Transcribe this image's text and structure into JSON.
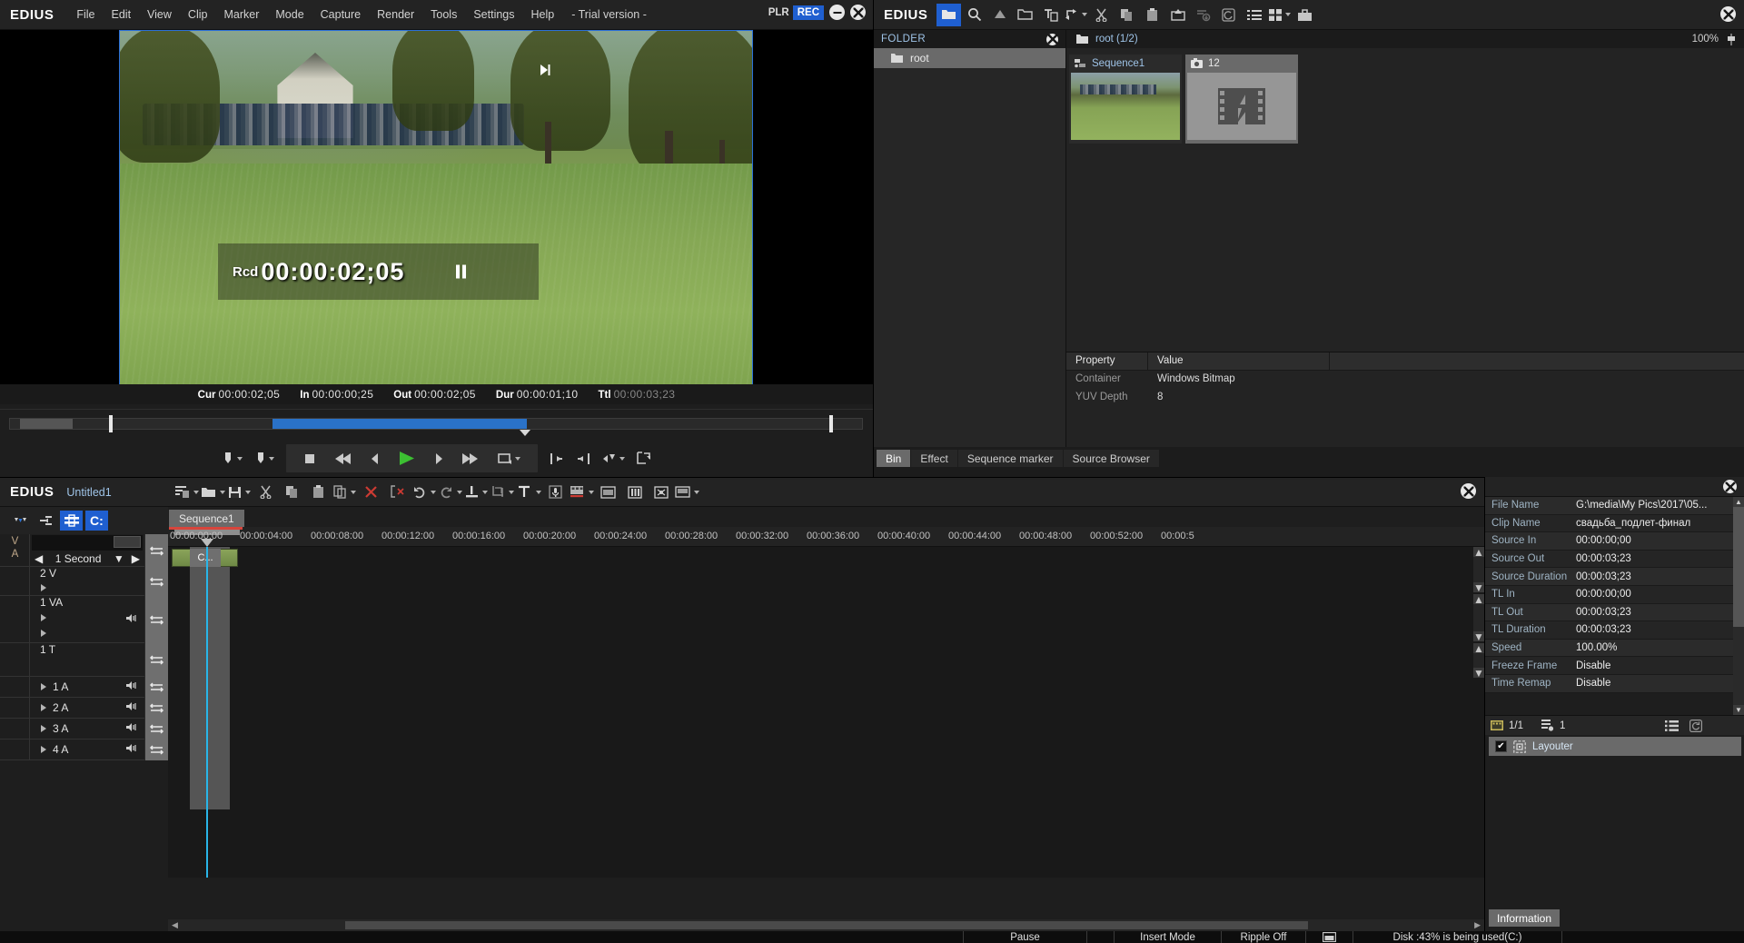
{
  "player": {
    "logo": "EDIUS",
    "menu": [
      "File",
      "Edit",
      "View",
      "Clip",
      "Marker",
      "Mode",
      "Capture",
      "Render",
      "Tools",
      "Settings",
      "Help"
    ],
    "trial": "- Trial version -",
    "plr_label": "PLR",
    "rec_label": "REC",
    "overlay": {
      "prefix": "Rcd",
      "timecode": "00:00:02;05"
    },
    "timecodes": [
      {
        "label": "Cur",
        "value": "00:00:02;05",
        "dim": false
      },
      {
        "label": "In",
        "value": "00:00:00;25",
        "dim": false
      },
      {
        "label": "Out",
        "value": "00:00:02;05",
        "dim": false
      },
      {
        "label": "Dur",
        "value": "00:00:01;10",
        "dim": false
      },
      {
        "label": "Ttl",
        "value": "00:00:03;23",
        "dim": true
      }
    ]
  },
  "bin": {
    "logo": "EDIUS",
    "folder_header": "FOLDER",
    "folder_item": "root",
    "path": "root (1/2)",
    "zoom": "100%",
    "cards": [
      {
        "name": "Sequence1",
        "kind": "sequence"
      },
      {
        "name": "12",
        "kind": "bitmap"
      }
    ],
    "property_headers": [
      "Property",
      "Value"
    ],
    "properties": [
      {
        "key": "Container",
        "value": "Windows Bitmap"
      },
      {
        "key": "YUV Depth",
        "value": "8"
      }
    ],
    "tabs": [
      "Bin",
      "Effect",
      "Sequence marker",
      "Source Browser"
    ],
    "active_tab": "Bin"
  },
  "timeline": {
    "logo": "EDIUS",
    "project_title": "Untitled1",
    "sequence_tab": "Sequence1",
    "zoom_scale": "1 Second",
    "va_labels": [
      "V",
      "A"
    ],
    "ruler_ticks": [
      "00:00:00:00",
      "00:00:04:00",
      "00:00:08:00",
      "00:00:12:00",
      "00:00:16:00",
      "00:00:20:00",
      "00:00:24:00",
      "00:00:28:00",
      "00:00:32:00",
      "00:00:36:00",
      "00:00:40:00",
      "00:00:44:00",
      "00:00:48:00",
      "00:00:52:00",
      "00:00:5"
    ],
    "tracks": [
      {
        "label": "2 V",
        "type": "video",
        "expanders": 1
      },
      {
        "label": "1 VA",
        "type": "videoaudio",
        "expanders": 2
      },
      {
        "label": "1 T",
        "type": "title",
        "expanders": 0
      },
      {
        "label": "1 A",
        "type": "audio",
        "expanders": 1
      },
      {
        "label": "2 A",
        "type": "audio",
        "expanders": 1
      },
      {
        "label": "3 A",
        "type": "audio",
        "expanders": 1
      },
      {
        "label": "4 A",
        "type": "audio",
        "expanders": 1
      }
    ],
    "clip_label": "C..."
  },
  "information": {
    "rows": [
      {
        "key": "File Name",
        "value": "G:\\media\\My Pics\\2017\\05..."
      },
      {
        "key": "Clip Name",
        "value": "свадьба_подлет-финал"
      },
      {
        "key": "Source In",
        "value": "00:00:00;00"
      },
      {
        "key": "Source Out",
        "value": "00:00:03;23"
      },
      {
        "key": "Source Duration",
        "value": "00:00:03;23"
      },
      {
        "key": "TL In",
        "value": "00:00:00;00"
      },
      {
        "key": "TL Out",
        "value": "00:00:03;23"
      },
      {
        "key": "TL Duration",
        "value": "00:00:03;23"
      },
      {
        "key": "Speed",
        "value": "100.00%"
      },
      {
        "key": "Freeze Frame",
        "value": "Disable"
      },
      {
        "key": "Time Remap",
        "value": "Disable"
      }
    ],
    "page_count": "1/1",
    "effect_count": "1",
    "effect_name": "Layouter",
    "tab_label": "Information"
  },
  "statusbar": {
    "pause": "Pause",
    "insert_mode": "Insert Mode",
    "ripple": "Ripple Off",
    "disk": "Disk :43% is being used(C:)"
  },
  "colors": {
    "accent_blue": "#1f5fd0",
    "playhead": "#29b5e8",
    "red_marker": "#d8453c",
    "link_text": "#9fc4e8"
  }
}
